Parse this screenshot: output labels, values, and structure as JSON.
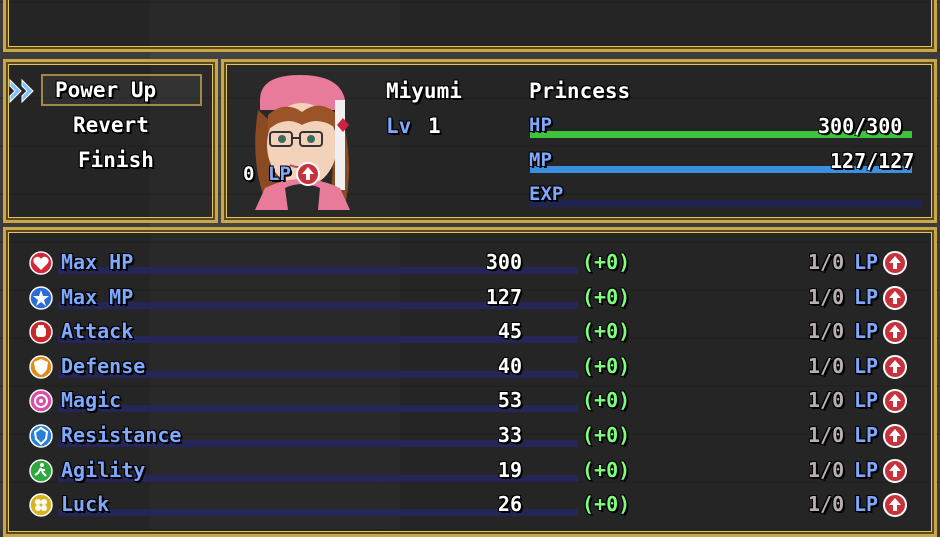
{
  "menu": {
    "items": [
      "Power Up",
      "Revert",
      "Finish"
    ],
    "selected": 0
  },
  "actor": {
    "name": "Miyumi",
    "class": "Princess",
    "level_label": "Lv",
    "level": "1",
    "lp_value": "0",
    "lp_label": "LP",
    "hp_label": "HP",
    "hp_text": "300/300",
    "hp_ratio": 1.0,
    "mp_label": "MP",
    "mp_text": "127/127",
    "mp_ratio": 1.0,
    "exp_label": "EXP",
    "exp_ratio": 0.0
  },
  "colors": {
    "hp": "#3cc43c",
    "mp": "#3a8fe0",
    "accent": "#c9a64a",
    "bonus": "#7dff7d",
    "stat_label": "#7fa8ff",
    "lp_icon": "#c8323c"
  },
  "stats": [
    {
      "name": "Max HP",
      "value": "300",
      "bonus": "(+0)",
      "cost": "1/0",
      "lp": "LP",
      "icon": "heart-icon",
      "color": "#d2283c"
    },
    {
      "name": "Max MP",
      "value": "127",
      "bonus": "(+0)",
      "cost": "1/0",
      "lp": "LP",
      "icon": "star-icon",
      "color": "#2c6cd6"
    },
    {
      "name": "Attack",
      "value": "45",
      "bonus": "(+0)",
      "cost": "1/0",
      "lp": "LP",
      "icon": "fist-icon",
      "color": "#c82828"
    },
    {
      "name": "Defense",
      "value": "40",
      "bonus": "(+0)",
      "cost": "1/0",
      "lp": "LP",
      "icon": "shield-icon",
      "color": "#e08a1c"
    },
    {
      "name": "Magic",
      "value": "53",
      "bonus": "(+0)",
      "cost": "1/0",
      "lp": "LP",
      "icon": "magic-icon",
      "color": "#d84ea8"
    },
    {
      "name": "Resistance",
      "value": "33",
      "bonus": "(+0)",
      "cost": "1/0",
      "lp": "LP",
      "icon": "resist-shield-icon",
      "color": "#2a80d8"
    },
    {
      "name": "Agility",
      "value": "19",
      "bonus": "(+0)",
      "cost": "1/0",
      "lp": "LP",
      "icon": "runner-icon",
      "color": "#2ca83c"
    },
    {
      "name": "Luck",
      "value": "26",
      "bonus": "(+0)",
      "cost": "1/0",
      "lp": "LP",
      "icon": "clover-icon",
      "color": "#d8b420"
    }
  ]
}
